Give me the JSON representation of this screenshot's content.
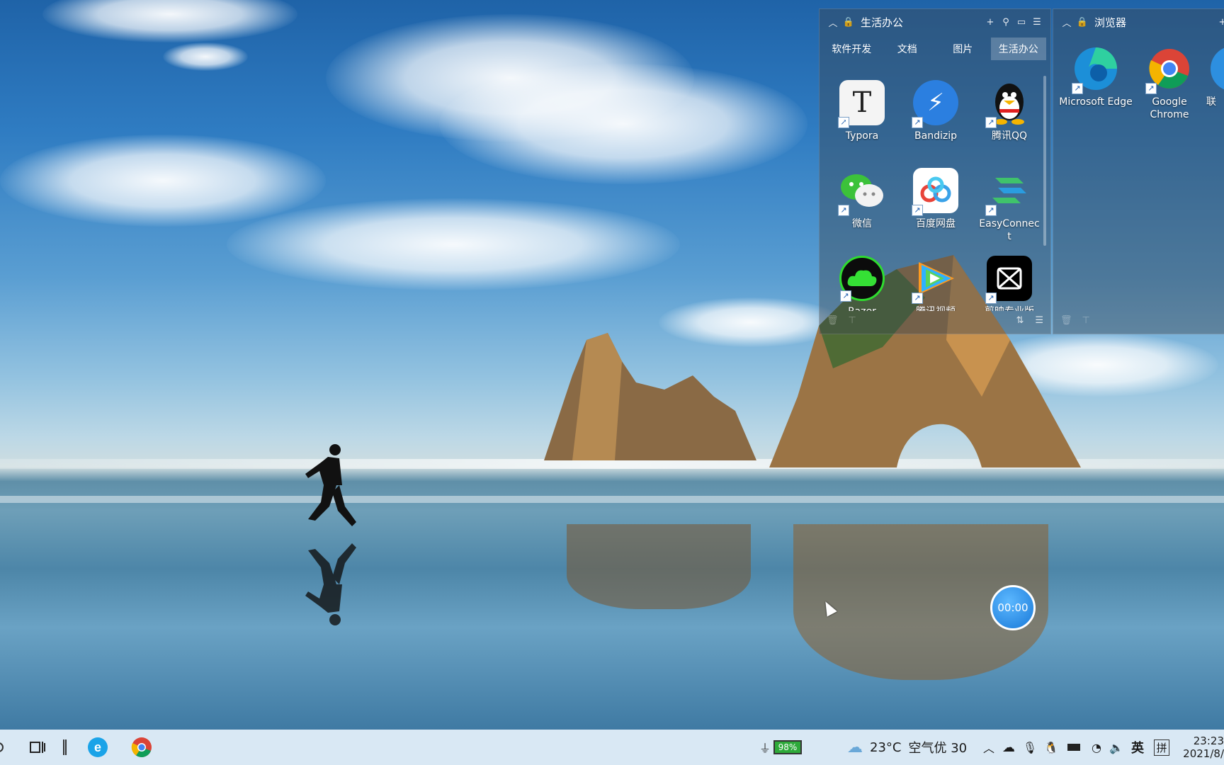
{
  "fence_office": {
    "title": "生活办公",
    "tabs": [
      "软件开发",
      "文档",
      "图片",
      "生活办公"
    ],
    "active_tab": "生活办公",
    "apps": [
      {
        "label": "Typora",
        "icon": "typora-icon"
      },
      {
        "label": "Bandizip",
        "icon": "bandizip-icon"
      },
      {
        "label": "腾讯QQ",
        "icon": "qq-icon"
      },
      {
        "label": "微信",
        "icon": "wechat-icon"
      },
      {
        "label": "百度网盘",
        "icon": "baidu-netdisk-icon"
      },
      {
        "label": "EasyConnect",
        "icon": "easyconnect-icon"
      },
      {
        "label": "Razer",
        "icon": "razer-icon"
      },
      {
        "label": "腾讯视频",
        "icon": "tencent-video-icon"
      },
      {
        "label": "剪映专业版",
        "icon": "capcut-icon"
      }
    ]
  },
  "fence_browser": {
    "title": "浏览器",
    "apps": [
      {
        "label": "Microsoft Edge",
        "icon": "edge-icon"
      },
      {
        "label": "Google Chrome",
        "icon": "chrome-icon"
      },
      {
        "label": "联",
        "icon": "app-icon"
      }
    ]
  },
  "timer": {
    "value": "00:00"
  },
  "taskbar": {
    "battery": "98%",
    "weather_temp": "23°C",
    "air_quality": "空气优 30",
    "ime_lang": "英",
    "ime_mode": "拼",
    "time": "23:23",
    "date": "2021/8/"
  },
  "colors": {
    "taskbar_bg": "#d9e8f4",
    "fence_bg": "rgba(60,70,78,.42)",
    "timer": "#1979d8"
  }
}
